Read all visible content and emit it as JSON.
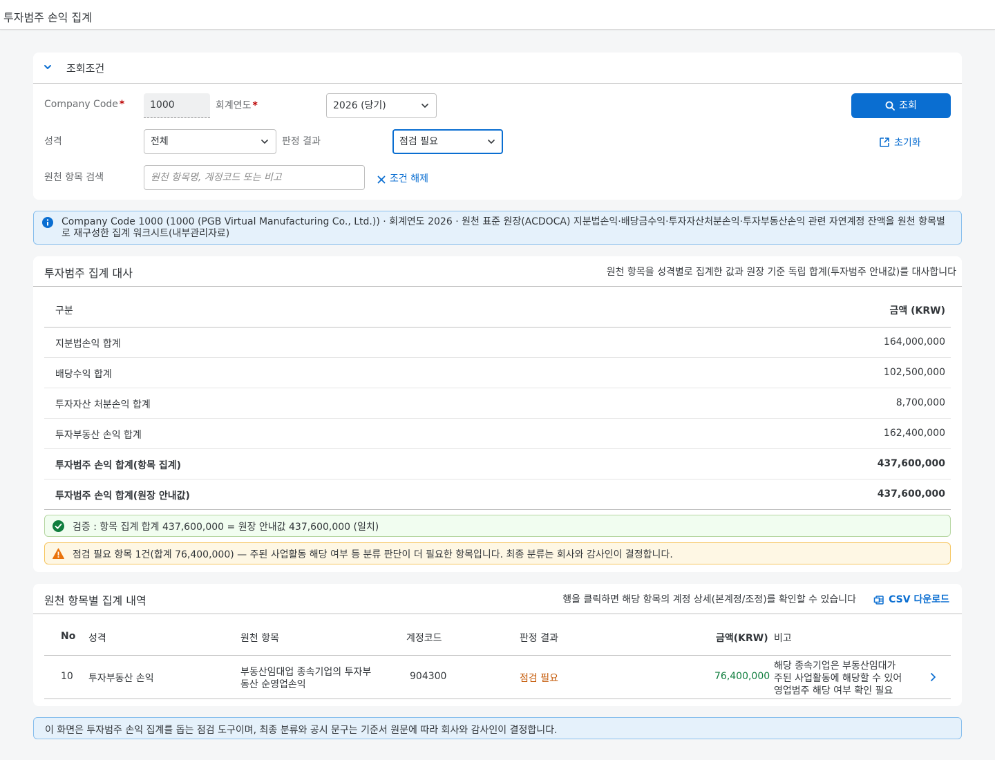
{
  "app": {
    "title": "투자범주 손익 집계"
  },
  "filter": {
    "section_title": "조회조건",
    "company_code_label": "Company Code",
    "company_code_value": "1000",
    "fiscal_year_label": "회계연도",
    "fiscal_year_value": "2026 (당기)",
    "nature_label": "성격",
    "nature_value": "전체",
    "judgment_label": "판정 결과",
    "judgment_value": "점검 필요",
    "search_label": "원천 항목 검색",
    "search_placeholder": "원천 항목명, 계정코드 또는 비고",
    "search_value": "",
    "clear_label": "조건 해제",
    "query_button": "조회",
    "reset_button": "초기화",
    "required_mark": "*"
  },
  "info": {
    "text": "Company Code 1000 (1000 (PGB Virtual Manufacturing Co., Ltd.)) · 회계연도 2026 · 원천 표준 원장(ACDOCA) 지분법손익·배당금수익·투자자산처분손익·투자부동산손익 관련 자연계정 잔액을 원천 항목별로 재구성한 집계 워크시트(내부관리자료)"
  },
  "reconciliation": {
    "title": "투자범주 집계 대사",
    "subtitle": "원천 항목을 성격별로 집계한 값과 원장 기준 독립 합계(투자범주 안내값)를 대사합니다",
    "columns": {
      "category": "구분",
      "amount": "금액 (KRW)"
    },
    "rows": [
      {
        "label": "지분법손익 합계",
        "amount": "164,000,000"
      },
      {
        "label": "배당수익 합계",
        "amount": "102,500,000"
      },
      {
        "label": "투자자산 처분손익 합계",
        "amount": "8,700,000"
      },
      {
        "label": "투자부동산 손익 합계",
        "amount": "162,400,000"
      },
      {
        "label": "투자범주 손익 합계(항목 집계)",
        "amount": "437,600,000"
      },
      {
        "label": "투자범주 손익 합계(원장 안내값)",
        "amount": "437,600,000"
      }
    ],
    "success_message": "검증 : 항목 집계 합계 437,600,000 = 원장 안내값 437,600,000 (일치)",
    "warning_message": "점검 필요 항목 1건(합계 76,400,000) — 주된 사업활동 해당 여부 등 분류 판단이 더 필요한 항목입니다. 최종 분류는 회사와 감사인이 결정합니다.",
    "colors": {
      "success": "#107e3e",
      "warning": "#e9730c"
    }
  },
  "detail": {
    "title": "원천 항목별 집계 내역",
    "hint": "행을 클릭하면 해당 항목의 계정 상세(본계정/조정)를 확인할 수 있습니다",
    "csv_label": "CSV 다운로드",
    "columns": {
      "no": "No",
      "nature": "성격",
      "source": "원천 항목",
      "account": "계정코드",
      "judgment": "판정 결과",
      "amount": "금액(KRW)",
      "note": "비고"
    },
    "rows": [
      {
        "no": "10",
        "nature": "투자부동산 손익",
        "source_line1": "부동산임대업 종속기업의 투자부",
        "source_line2": "동산 순영업손익",
        "account": "904300",
        "judgment": "점검 필요",
        "amount": "76,400,000",
        "note_line1": "해당 종속기업은 부동산임대가",
        "note_line2": "주된 사업활동에 해당할 수 있어",
        "note_line3": "영업범주 해당 여부 확인 필요"
      }
    ]
  },
  "footer": {
    "text": "이 화면은 투자범주 손익 집계를 돕는 점검 도구이며, 최종 분류와 공시 문구는 기준서 원문에 따라 회사와 감사인이 결정합니다."
  },
  "accent_color": "#0a6ed1"
}
